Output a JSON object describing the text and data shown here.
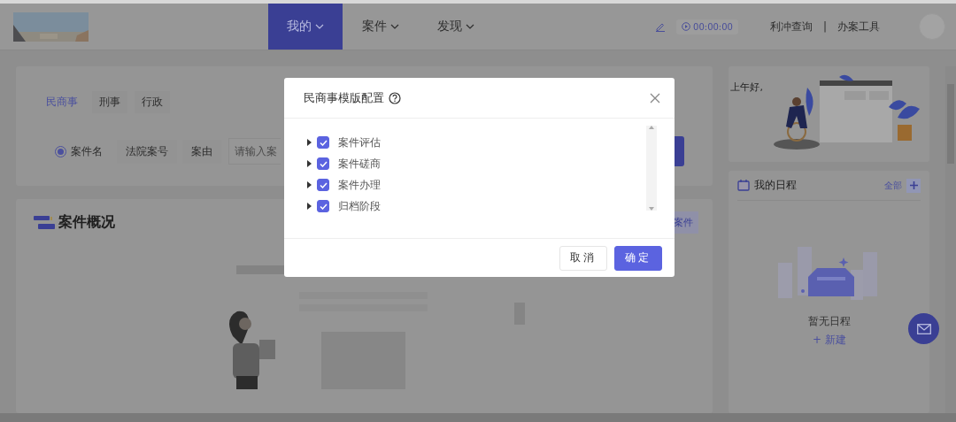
{
  "header": {
    "nav": [
      {
        "label": "我的",
        "selected": true
      },
      {
        "label": "案件",
        "selected": false
      },
      {
        "label": "发现",
        "selected": false
      }
    ],
    "timer": "00:00:00",
    "links": [
      "利冲查询",
      "办案工具"
    ],
    "separator": "|"
  },
  "search_card": {
    "tabs": [
      {
        "label": "民商事",
        "selected": true
      },
      {
        "label": "刑事",
        "selected": false
      },
      {
        "label": "行政",
        "selected": false
      }
    ],
    "modes": [
      {
        "label": "案件名",
        "selected": true
      },
      {
        "label": "法院案号",
        "selected": false
      },
      {
        "label": "案由",
        "selected": false
      }
    ],
    "input": {
      "placeholder": "请输入案"
    }
  },
  "overview": {
    "title": "案件概况",
    "new_button": "案件"
  },
  "greeting": "上午好,",
  "schedule": {
    "title": "我的日程",
    "all_link": "全部",
    "empty": "暂无日程",
    "new_link": "+ 新建"
  },
  "dialog": {
    "title": "民商事模版配置",
    "items": [
      {
        "label": "案件评估",
        "checked": true,
        "expanded": false
      },
      {
        "label": "案件磋商",
        "checked": true,
        "expanded": false
      },
      {
        "label": "案件办理",
        "checked": true,
        "expanded": false
      },
      {
        "label": "归档阶段",
        "checked": true,
        "expanded": false
      }
    ],
    "cancel": "取消",
    "confirm": "确定"
  }
}
